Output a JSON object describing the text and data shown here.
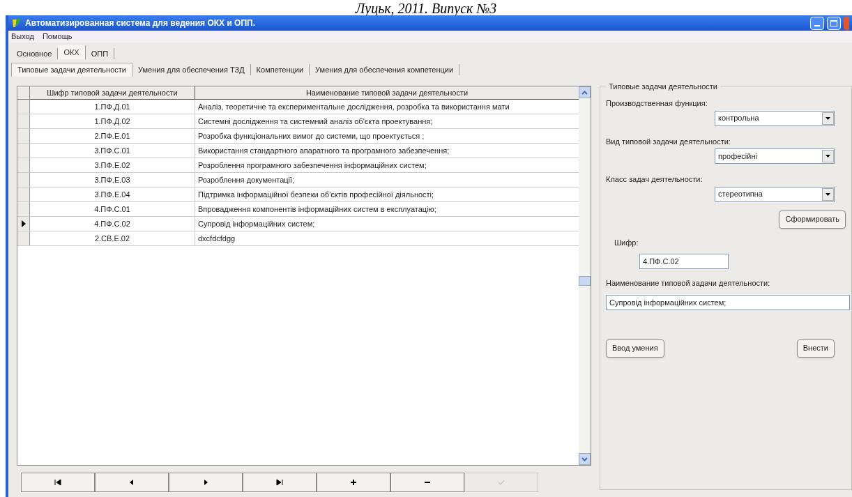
{
  "page_header": "Луцьк, 2011. Випуск №3",
  "window": {
    "title": "Автоматизированная система для ведения ОКХ и ОПП."
  },
  "menu": [
    "Выход",
    "Помощь"
  ],
  "tabs": [
    {
      "label": "Основное",
      "selected": false
    },
    {
      "label": "ОКХ",
      "selected": true
    },
    {
      "label": "ОПП",
      "selected": false
    }
  ],
  "subtabs": [
    {
      "label": "Типовые задачи деятельности",
      "selected": true
    },
    {
      "label": "Умения для обеспечения ТЗД",
      "selected": false
    },
    {
      "label": "Компетенции",
      "selected": false
    },
    {
      "label": "Умения для обеспечения компетенции",
      "selected": false
    }
  ],
  "table": {
    "columns": [
      "Шифр типовой задачи деятельности",
      "Наименование типовой задачи деятельности"
    ],
    "rows": [
      {
        "code": "1.ПФ.Д.01",
        "name": "Аналіз, теоретичне та експериментальне дослідження,  розробка та використання мати",
        "selected": false
      },
      {
        "code": "1.ПФ.Д.02",
        "name": "Системні дослідження та системний аналіз об'єкта проектування;",
        "selected": false
      },
      {
        "code": "2.ПФ.Е.01",
        "name": "Розробка функціональних вимог до системи, що проектується ;",
        "selected": false
      },
      {
        "code": "3.ПФ.С.01",
        "name": "Використання стандартного апаратного та програмного забезпечення;",
        "selected": false
      },
      {
        "code": "3.ПФ.Е.02",
        "name": "Розроблення програмного забезпечення інформаційних систем;",
        "selected": false
      },
      {
        "code": "3.ПФ.Е.03",
        "name": "Розроблення документації;",
        "selected": false
      },
      {
        "code": "3.ПФ.Е.04",
        "name": "Підтримка інформаційної безпеки об'єктів професійної діяльності;",
        "selected": false
      },
      {
        "code": "4.ПФ.С.01",
        "name": "Впровадження компонентів інформаційних систем в експлуатацію;",
        "selected": false
      },
      {
        "code": "4.ПФ.С.02",
        "name": "Супровід інформаційних систем;",
        "selected": true
      },
      {
        "code": "2.СВ.Е.02",
        "name": "dxcfdcfdgg",
        "selected": false
      }
    ]
  },
  "navigator": [
    {
      "kind": "first",
      "disabled": false
    },
    {
      "kind": "prior",
      "disabled": false
    },
    {
      "kind": "next",
      "disabled": false
    },
    {
      "kind": "last",
      "disabled": false
    },
    {
      "kind": "insert",
      "disabled": false
    },
    {
      "kind": "delete",
      "disabled": false
    },
    {
      "kind": "post",
      "disabled": true
    }
  ],
  "panel": {
    "title": "Типовые задачи деятельности",
    "combos": [
      {
        "label": "Производственная функция:",
        "value": "контрольна"
      },
      {
        "label": "Вид типовой задачи деятельности:",
        "value": "професійні"
      },
      {
        "label": "Класс задач деятельности:",
        "value": "стереотипна"
      }
    ],
    "form_button": "Сформировать",
    "code_label": "Шифр:",
    "code_value": "4.ПФ.С.02",
    "name_label": "Наименование типовой задачи деятельности:",
    "name_value": "Супровід інформаційних систем;",
    "buttons": [
      "Ввод умения",
      "Внести"
    ]
  }
}
